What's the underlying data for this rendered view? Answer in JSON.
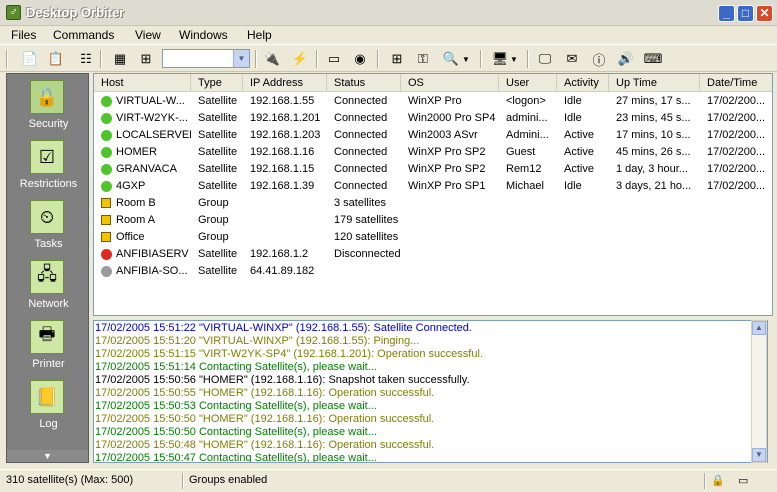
{
  "window": {
    "title": "Desktop Orbiter",
    "minimize": "_",
    "maximize": "□",
    "close": "✕"
  },
  "menu": [
    "Files",
    "Commands",
    "View",
    "Windows",
    "Help"
  ],
  "toolbar": {
    "combo_value": ""
  },
  "sidebar": {
    "items": [
      {
        "label": "Security",
        "icon": "security-icon"
      },
      {
        "label": "Restrictions",
        "icon": "restrictions-icon"
      },
      {
        "label": "Tasks",
        "icon": "tasks-icon"
      },
      {
        "label": "Network",
        "icon": "network-icon"
      },
      {
        "label": "Printer",
        "icon": "printer-icon"
      },
      {
        "label": "Log",
        "icon": "log-icon"
      }
    ]
  },
  "grid": {
    "columns": [
      "Host",
      "Type",
      "IP Address",
      "Status",
      "OS",
      "User",
      "Activity",
      "Up Time",
      "Date/Time"
    ],
    "rows": [
      {
        "status_color": "#4ec52b",
        "kind": "dot",
        "cells": [
          "VIRTUAL-W...",
          "Satellite",
          "192.168.1.55",
          "Connected",
          "WinXP Pro",
          "<logon>",
          "Idle",
          "27 mins, 17 s...",
          "17/02/200..."
        ]
      },
      {
        "status_color": "#4ec52b",
        "kind": "dot",
        "cells": [
          "VIRT-W2YK-...",
          "Satellite",
          "192.168.1.201",
          "Connected",
          "Win2000 Pro SP4",
          "admini...",
          "Idle",
          "23 mins, 45 s...",
          "17/02/200..."
        ]
      },
      {
        "status_color": "#4ec52b",
        "kind": "dot",
        "cells": [
          "LOCALSERVER",
          "Satellite",
          "192.168.1.203",
          "Connected",
          "Win2003 ASvr",
          "Admini...",
          "Active",
          "17 mins, 10 s...",
          "17/02/200..."
        ]
      },
      {
        "status_color": "#4ec52b",
        "kind": "dot",
        "cells": [
          "HOMER",
          "Satellite",
          "192.168.1.16",
          "Connected",
          "WinXP Pro SP2",
          "Guest",
          "Active",
          "45 mins, 26 s...",
          "17/02/200..."
        ]
      },
      {
        "status_color": "#4ec52b",
        "kind": "dot",
        "cells": [
          "GRANVACA",
          "Satellite",
          "192.168.1.15",
          "Connected",
          "WinXP Pro SP2",
          "Rem12",
          "Active",
          "1 day, 3 hour...",
          "17/02/200..."
        ]
      },
      {
        "status_color": "#4ec52b",
        "kind": "dot",
        "cells": [
          "4GXP",
          "Satellite",
          "192.168.1.39",
          "Connected",
          "WinXP Pro SP1",
          "Michael",
          "Idle",
          "3 days, 21 ho...",
          "17/02/200..."
        ]
      },
      {
        "status_color": "#f3c200",
        "kind": "group",
        "cells": [
          "Room B",
          "Group",
          "",
          "3 satellites",
          "",
          "",
          "",
          "",
          ""
        ]
      },
      {
        "status_color": "#f3c200",
        "kind": "group",
        "cells": [
          "Room A",
          "Group",
          "",
          "179 satellites",
          "",
          "",
          "",
          "",
          ""
        ]
      },
      {
        "status_color": "#f3c200",
        "kind": "group",
        "cells": [
          "Office",
          "Group",
          "",
          "120 satellites",
          "",
          "",
          "",
          "",
          ""
        ]
      },
      {
        "status_color": "#e0281e",
        "kind": "dot",
        "cells": [
          "ANFIBIASERV",
          "Satellite",
          "192.168.1.2",
          "Disconnected",
          "",
          "",
          "",
          "",
          ""
        ]
      },
      {
        "status_color": "#9a9a9a",
        "kind": "dot",
        "cells": [
          "ANFIBIA-SO...",
          "Satellite",
          "64.41.89.182",
          "",
          "",
          "",
          "",
          "",
          ""
        ]
      }
    ]
  },
  "log": [
    {
      "color": "#0000c0",
      "text": "17/02/2005 15:51:22  \"VIRTUAL-WINXP\" (192.168.1.55): Satellite Connected."
    },
    {
      "color": "#808000",
      "text": "17/02/2005 15:51:20  \"VIRTUAL-WINXP\" (192.168.1.55): Pinging..."
    },
    {
      "color": "#808000",
      "text": "17/02/2005 15:51:15  \"VIRT-W2YK-SP4\" (192.168.1.201): Operation successful."
    },
    {
      "color": "#008000",
      "text": "17/02/2005 15:51:14  Contacting Satellite(s), please wait..."
    },
    {
      "color": "#000000",
      "text": "17/02/2005 15:50:56  \"HOMER\" (192.168.1.16): Snapshot taken successfully."
    },
    {
      "color": "#808000",
      "text": "17/02/2005 15:50:55  \"HOMER\" (192.168.1.16): Operation successful."
    },
    {
      "color": "#008000",
      "text": "17/02/2005 15:50:53  Contacting Satellite(s), please wait..."
    },
    {
      "color": "#808000",
      "text": "17/02/2005 15:50:50  \"HOMER\" (192.168.1.16): Operation successful."
    },
    {
      "color": "#008000",
      "text": "17/02/2005 15:50:50  Contacting Satellite(s), please wait..."
    },
    {
      "color": "#808000",
      "text": "17/02/2005 15:50:48  \"HOMER\" (192.168.1.16): Operation successful."
    },
    {
      "color": "#008000",
      "text": "17/02/2005 15:50:47  Contacting Satellite(s), please wait..."
    }
  ],
  "status": {
    "count": "310 satellite(s) (Max: 500)",
    "groups": "Groups enabled"
  }
}
